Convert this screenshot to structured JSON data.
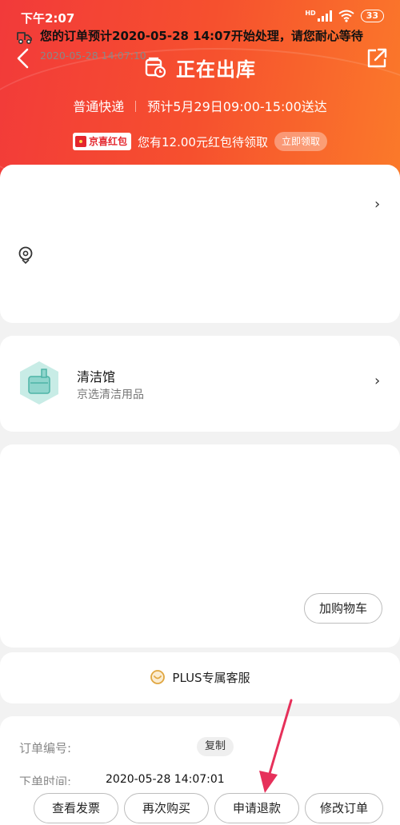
{
  "status_bar": {
    "time": "下午2:07",
    "battery": "33",
    "network_tag": "HD"
  },
  "header": {
    "title": "正在出库",
    "delivery_type": "普通快递",
    "delivery_eta": "预计5月29日09:00-15:00送达",
    "promo_badge": "京喜红包",
    "promo_text": "您有12.00元红包待领取",
    "promo_button": "立即领取"
  },
  "tracking": {
    "message": "您的订单预计2020-05-28 14:07开始处理，请您耐心等待",
    "timestamp": "2020-05-28 14:07:10"
  },
  "shop": {
    "name": "清洁馆",
    "subtitle": "京选清洁用品"
  },
  "product": {
    "add_to_cart": "加购物车"
  },
  "service": {
    "label": "PLUS专属客服"
  },
  "order_info": {
    "number_label": "订单编号:",
    "copy_button": "复制",
    "time_label": "下单时间:",
    "time_value": "2020-05-28 14:07:01"
  },
  "bottom_actions": {
    "invoice": "查看发票",
    "rebuy": "再次购买",
    "refund": "申请退款",
    "modify": "修改订单"
  },
  "colors": {
    "brand_red": "#f23a3a",
    "brand_orange": "#fb7a2a",
    "annotation_arrow": "#e6305a"
  }
}
